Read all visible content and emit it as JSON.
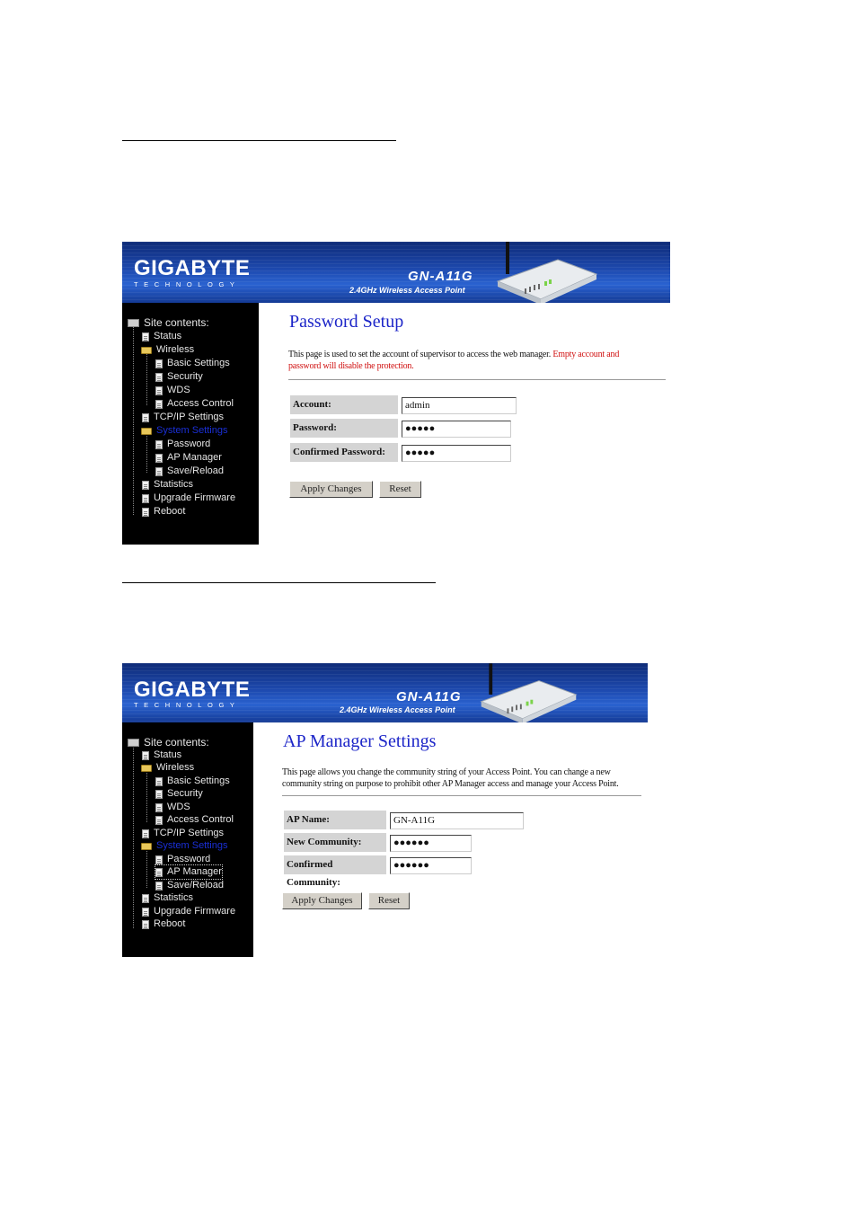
{
  "panels": [
    {
      "brand": {
        "logo": "GIGABYTE",
        "logo_sub": "TECHNOLOGY",
        "model": "GN-A11G",
        "model_sub": "2.4GHz Wireless Access Point"
      },
      "sidebar": {
        "title": "Site contents:",
        "items": [
          "Status",
          "Wireless",
          "Basic Settings",
          "Security",
          "WDS",
          "Access Control",
          "TCP/IP Settings",
          "System Settings",
          "Password",
          "AP Manager",
          "Save/Reload",
          "Statistics",
          "Upgrade Firmware",
          "Reboot"
        ]
      },
      "page_title": "Password Setup",
      "description": "This page is used to set the account of supervisor to access the web manager.",
      "description_warning": "Empty account and password will disable the protection.",
      "fields": [
        {
          "label": "Account:",
          "value": "admin"
        },
        {
          "label": "Password:",
          "value": "●●●●●"
        },
        {
          "label": "Confirmed Password:",
          "value": "●●●●●"
        }
      ],
      "buttons": {
        "apply": "Apply Changes",
        "reset": "Reset"
      }
    },
    {
      "brand": {
        "logo": "GIGABYTE",
        "logo_sub": "TECHNOLOGY",
        "model": "GN-A11G",
        "model_sub": "2.4GHz Wireless Access Point"
      },
      "sidebar": {
        "title": "Site contents:",
        "items": [
          "Status",
          "Wireless",
          "Basic Settings",
          "Security",
          "WDS",
          "Access Control",
          "TCP/IP Settings",
          "System Settings",
          "Password",
          "AP Manager",
          "Save/Reload",
          "Statistics",
          "Upgrade Firmware",
          "Reboot"
        ]
      },
      "page_title": "AP Manager Settings",
      "description": "This page allows you change the community string of your Access Point. You can change a new community string on purpose to prohibit other AP Manager access and manage your Access Point.",
      "fields": [
        {
          "label": "AP Name:",
          "value": "GN-A11G"
        },
        {
          "label": "New Community:",
          "value": "●●●●●●"
        },
        {
          "label": "Confirmed Community:",
          "value": "●●●●●●"
        }
      ],
      "buttons": {
        "apply": "Apply Changes",
        "reset": "Reset"
      }
    }
  ]
}
